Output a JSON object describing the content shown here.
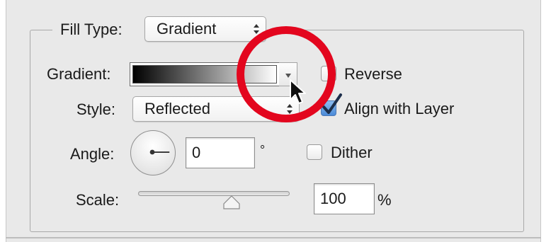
{
  "fill_type": {
    "label": "Fill Type:",
    "value": "Gradient"
  },
  "gradient": {
    "label": "Gradient:",
    "colors": [
      "#000000",
      "#ffffff"
    ]
  },
  "reverse": {
    "label": "Reverse",
    "checked": false
  },
  "style": {
    "label": "Style:",
    "value": "Reflected"
  },
  "align_with_layer": {
    "label": "Align with Layer",
    "checked": true
  },
  "angle": {
    "label": "Angle:",
    "value": "0",
    "unit": "°"
  },
  "dither": {
    "label": "Dither",
    "checked": false
  },
  "scale": {
    "label": "Scale:",
    "value": "100",
    "unit": "%"
  },
  "colors": {
    "highlight": "#e3061e",
    "checkbox_checked": "#4a8ad8",
    "panel_background": "#e9e9e9"
  },
  "icons": {
    "updown": "updown-chevrons-icon",
    "dropdown": "triangle-down-icon",
    "cursor": "mouse-pointer-icon",
    "checkmark": "checkmark-icon"
  }
}
